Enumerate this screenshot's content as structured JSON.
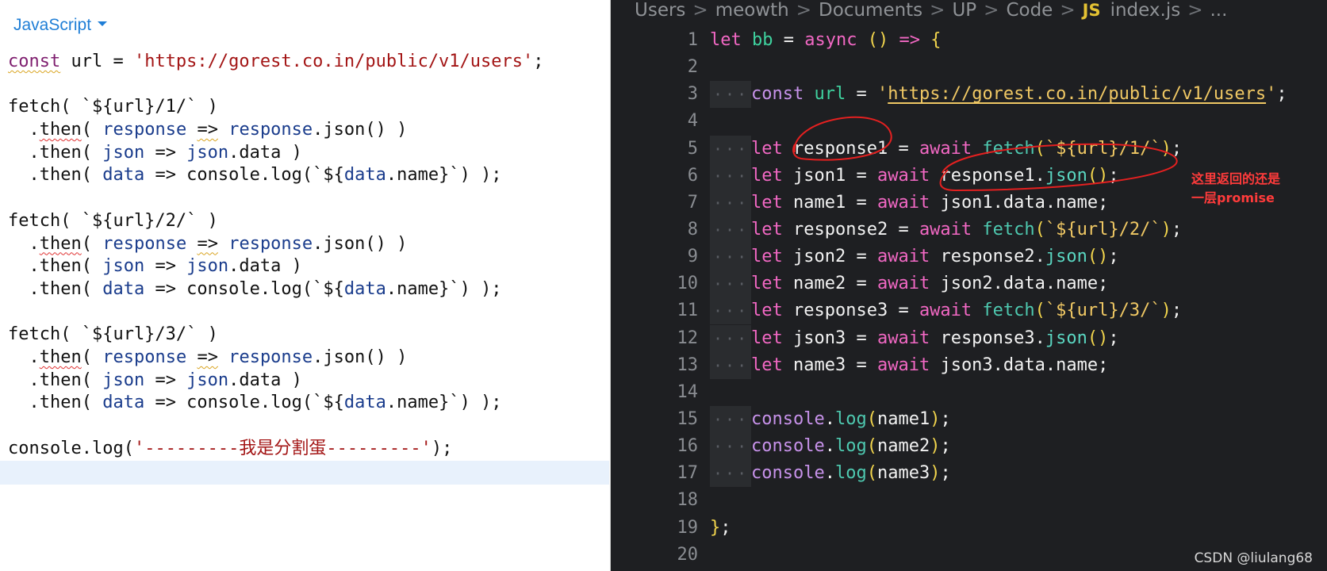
{
  "left": {
    "language": "JavaScript",
    "lines": [
      [
        [
          "const",
          "lk sq"
        ],
        [
          " url = ",
          ""
        ],
        [
          "'https://gorest.co.in/public/v1/users'",
          "ls"
        ],
        [
          ";",
          ""
        ]
      ],
      [],
      [
        [
          "fetch( `${url}/1/` )",
          ""
        ]
      ],
      [
        [
          "  .",
          ""
        ],
        [
          "then",
          "sqr"
        ],
        [
          "( ",
          ""
        ],
        [
          "response",
          "lv"
        ],
        [
          " ",
          ""
        ],
        [
          "=>",
          "sq"
        ],
        [
          " ",
          ""
        ],
        [
          "response",
          "lv"
        ],
        [
          ".json() )",
          ""
        ]
      ],
      [
        [
          "  .then( ",
          ""
        ],
        [
          "json",
          "lv"
        ],
        [
          " => ",
          ""
        ],
        [
          "json",
          "lv"
        ],
        [
          ".data )",
          ""
        ]
      ],
      [
        [
          "  .then( ",
          ""
        ],
        [
          "data",
          "lv"
        ],
        [
          " => console.log(`${",
          ""
        ],
        [
          "data",
          "lv"
        ],
        [
          ".name}`) );",
          ""
        ]
      ],
      [],
      [
        [
          "fetch( `${url}/2/` )",
          ""
        ]
      ],
      [
        [
          "  .",
          ""
        ],
        [
          "then",
          "sqr"
        ],
        [
          "( ",
          ""
        ],
        [
          "response",
          "lv"
        ],
        [
          " ",
          ""
        ],
        [
          "=>",
          "sq"
        ],
        [
          " ",
          ""
        ],
        [
          "response",
          "lv"
        ],
        [
          ".json() )",
          ""
        ]
      ],
      [
        [
          "  .then( ",
          ""
        ],
        [
          "json",
          "lv"
        ],
        [
          " => ",
          ""
        ],
        [
          "json",
          "lv"
        ],
        [
          ".data )",
          ""
        ]
      ],
      [
        [
          "  .then( ",
          ""
        ],
        [
          "data",
          "lv"
        ],
        [
          " => console.log(`${",
          ""
        ],
        [
          "data",
          "lv"
        ],
        [
          ".name}`) );",
          ""
        ]
      ],
      [],
      [
        [
          "fetch( `${url}/3/` )",
          ""
        ]
      ],
      [
        [
          "  .",
          ""
        ],
        [
          "then",
          "sqr"
        ],
        [
          "( ",
          ""
        ],
        [
          "response",
          "lv"
        ],
        [
          " ",
          ""
        ],
        [
          "=>",
          "sq"
        ],
        [
          " ",
          ""
        ],
        [
          "response",
          "lv"
        ],
        [
          ".json() )",
          ""
        ]
      ],
      [
        [
          "  .then( ",
          ""
        ],
        [
          "json",
          "lv"
        ],
        [
          " => ",
          ""
        ],
        [
          "json",
          "lv"
        ],
        [
          ".data )",
          ""
        ]
      ],
      [
        [
          "  .then( ",
          ""
        ],
        [
          "data",
          "lv"
        ],
        [
          " => console.log(`${",
          ""
        ],
        [
          "data",
          "lv"
        ],
        [
          ".name}`) );",
          ""
        ]
      ],
      [],
      [
        [
          "console.log(",
          ""
        ],
        [
          "'---------我是分割蛋---------'",
          "ls"
        ],
        [
          ");",
          ""
        ]
      ]
    ]
  },
  "right": {
    "breadcrumb": [
      "Users",
      "meowth",
      "Documents",
      "UP",
      "Code"
    ],
    "file_icon": "JS",
    "file_name": "index.js",
    "ellipsis": "...",
    "line_numbers": [
      "1",
      "2",
      "3",
      "4",
      "5",
      "6",
      "7",
      "8",
      "9",
      "10",
      "11",
      "12",
      "13",
      "14",
      "15",
      "16",
      "17",
      "18",
      "19",
      "20"
    ],
    "lines": [
      [
        [
          0
        ],
        [
          "let",
          "k"
        ],
        [
          " ",
          ""
        ],
        [
          "bb",
          "v"
        ],
        [
          " = ",
          "w"
        ],
        [
          "async",
          "k"
        ],
        [
          " ",
          ""
        ],
        [
          "()",
          "gold"
        ],
        [
          " => ",
          "k"
        ],
        [
          "{",
          "gold"
        ]
      ],
      [
        [
          0
        ]
      ],
      [
        [
          1
        ],
        [
          "const",
          "g"
        ],
        [
          " ",
          ""
        ],
        [
          "url",
          "v"
        ],
        [
          " = ",
          "w"
        ],
        [
          "'",
          "s"
        ],
        [
          "https://gorest.co.in/public/v1/users",
          "su"
        ],
        [
          "'",
          "s"
        ],
        [
          ";",
          "w"
        ]
      ],
      [
        [
          0
        ]
      ],
      [
        [
          1
        ],
        [
          "let",
          "k"
        ],
        [
          " response1 = ",
          "w"
        ],
        [
          "await",
          "k"
        ],
        [
          " ",
          ""
        ],
        [
          "fetch",
          "f"
        ],
        [
          "(",
          "gold"
        ],
        [
          "`${url}/1/`",
          "s"
        ],
        [
          ")",
          "gold"
        ],
        [
          ";",
          "w"
        ]
      ],
      [
        [
          1
        ],
        [
          "let",
          "k"
        ],
        [
          " json1 = ",
          "w"
        ],
        [
          "await",
          "k"
        ],
        [
          " response1.",
          "w"
        ],
        [
          "json",
          "fc"
        ],
        [
          "()",
          "gold"
        ],
        [
          ";",
          "w"
        ]
      ],
      [
        [
          1
        ],
        [
          "let",
          "k"
        ],
        [
          " name1 = ",
          "w"
        ],
        [
          "await",
          "k"
        ],
        [
          " json1.data.name;",
          "w"
        ]
      ],
      [
        [
          1
        ],
        [
          "let",
          "k"
        ],
        [
          " response2 = ",
          "w"
        ],
        [
          "await",
          "k"
        ],
        [
          " ",
          ""
        ],
        [
          "fetch",
          "f"
        ],
        [
          "(",
          "gold"
        ],
        [
          "`${url}/2/`",
          "s"
        ],
        [
          ")",
          "gold"
        ],
        [
          ";",
          "w"
        ]
      ],
      [
        [
          1
        ],
        [
          "let",
          "k"
        ],
        [
          " json2 = ",
          "w"
        ],
        [
          "await",
          "k"
        ],
        [
          " response2.",
          "w"
        ],
        [
          "json",
          "fc"
        ],
        [
          "()",
          "gold"
        ],
        [
          ";",
          "w"
        ]
      ],
      [
        [
          1
        ],
        [
          "let",
          "k"
        ],
        [
          " name2 = ",
          "w"
        ],
        [
          "await",
          "k"
        ],
        [
          " json2.data.name;",
          "w"
        ]
      ],
      [
        [
          1
        ],
        [
          "let",
          "k"
        ],
        [
          " response3 = ",
          "w"
        ],
        [
          "await",
          "k"
        ],
        [
          " ",
          ""
        ],
        [
          "fetch",
          "f"
        ],
        [
          "(",
          "gold"
        ],
        [
          "`${url}/3/`",
          "s"
        ],
        [
          ")",
          "gold"
        ],
        [
          ";",
          "w"
        ]
      ],
      [
        [
          1
        ],
        [
          "let",
          "k"
        ],
        [
          " json3 = ",
          "w"
        ],
        [
          "await",
          "k"
        ],
        [
          " response3.",
          "w"
        ],
        [
          "json",
          "fc"
        ],
        [
          "()",
          "gold"
        ],
        [
          ";",
          "w"
        ]
      ],
      [
        [
          1
        ],
        [
          "let",
          "k"
        ],
        [
          " name3 = ",
          "w"
        ],
        [
          "await",
          "k"
        ],
        [
          " json3.data.name;",
          "w"
        ]
      ],
      [
        [
          0
        ]
      ],
      [
        [
          1
        ],
        [
          "console",
          "g"
        ],
        [
          ".",
          "w"
        ],
        [
          "log",
          "f"
        ],
        [
          "(",
          "gold"
        ],
        [
          "name1",
          "w"
        ],
        [
          ")",
          "gold"
        ],
        [
          ";",
          "w"
        ]
      ],
      [
        [
          1
        ],
        [
          "console",
          "g"
        ],
        [
          ".",
          "w"
        ],
        [
          "log",
          "f"
        ],
        [
          "(",
          "gold"
        ],
        [
          "name2",
          "w"
        ],
        [
          ")",
          "gold"
        ],
        [
          ";",
          "w"
        ]
      ],
      [
        [
          1
        ],
        [
          "console",
          "g"
        ],
        [
          ".",
          "w"
        ],
        [
          "log",
          "f"
        ],
        [
          "(",
          "gold"
        ],
        [
          "name3",
          "w"
        ],
        [
          ")",
          "gold"
        ],
        [
          ";",
          "w"
        ]
      ],
      [
        [
          0
        ]
      ],
      [
        [
          0
        ],
        [
          "}",
          "gold"
        ],
        [
          ";",
          "w"
        ]
      ],
      [
        [
          0
        ]
      ]
    ],
    "annotation_text": "这里返回的还是\n一层promise",
    "watermark": "CSDN @liulang68"
  }
}
